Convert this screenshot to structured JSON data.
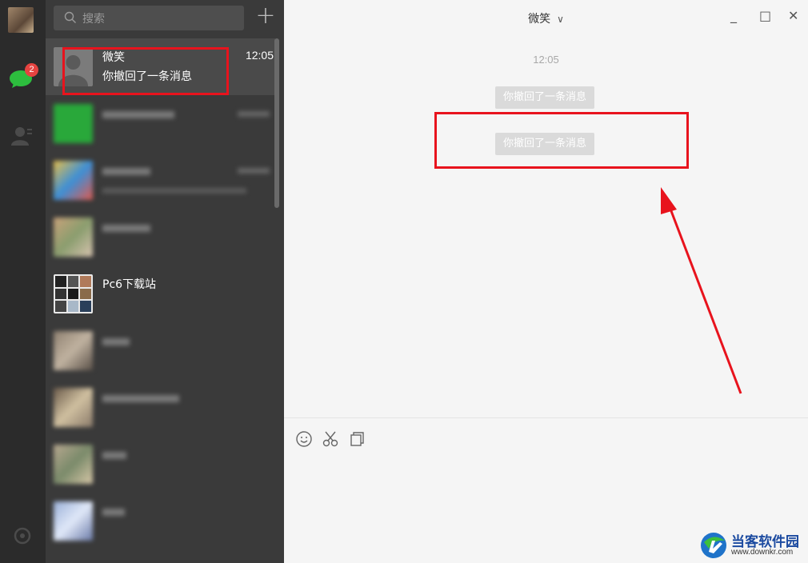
{
  "rail": {
    "unread_badge": "2"
  },
  "search": {
    "placeholder": "搜索"
  },
  "conversations": [
    {
      "name": "微笑",
      "preview": "你撤回了一条消息",
      "time": "12:05"
    },
    {
      "name": "",
      "preview": "",
      "time": ""
    },
    {
      "name": "",
      "preview": "",
      "time": ""
    },
    {
      "name": "",
      "preview": "",
      "time": ""
    },
    {
      "name": "Pc6下载站",
      "preview": "",
      "time": ""
    },
    {
      "name": "",
      "preview": "",
      "time": ""
    },
    {
      "name": "",
      "preview": "",
      "time": ""
    },
    {
      "name": "",
      "preview": "",
      "time": ""
    },
    {
      "name": "",
      "preview": "",
      "time": ""
    }
  ],
  "chat": {
    "title": "微笑",
    "timestamp": "12:05",
    "messages": [
      {
        "text": "你撤回了一条消息"
      },
      {
        "text": "你撤回了一条消息"
      }
    ]
  },
  "window_controls": {
    "minimize": "_",
    "maximize": "□",
    "close": "✕"
  },
  "watermark": {
    "name": "当客软件园",
    "url": "www.downkr.com"
  },
  "colors": {
    "accent_green": "#2dbe3e",
    "badge_red": "#e64340",
    "annotation_red": "#e8131d"
  }
}
